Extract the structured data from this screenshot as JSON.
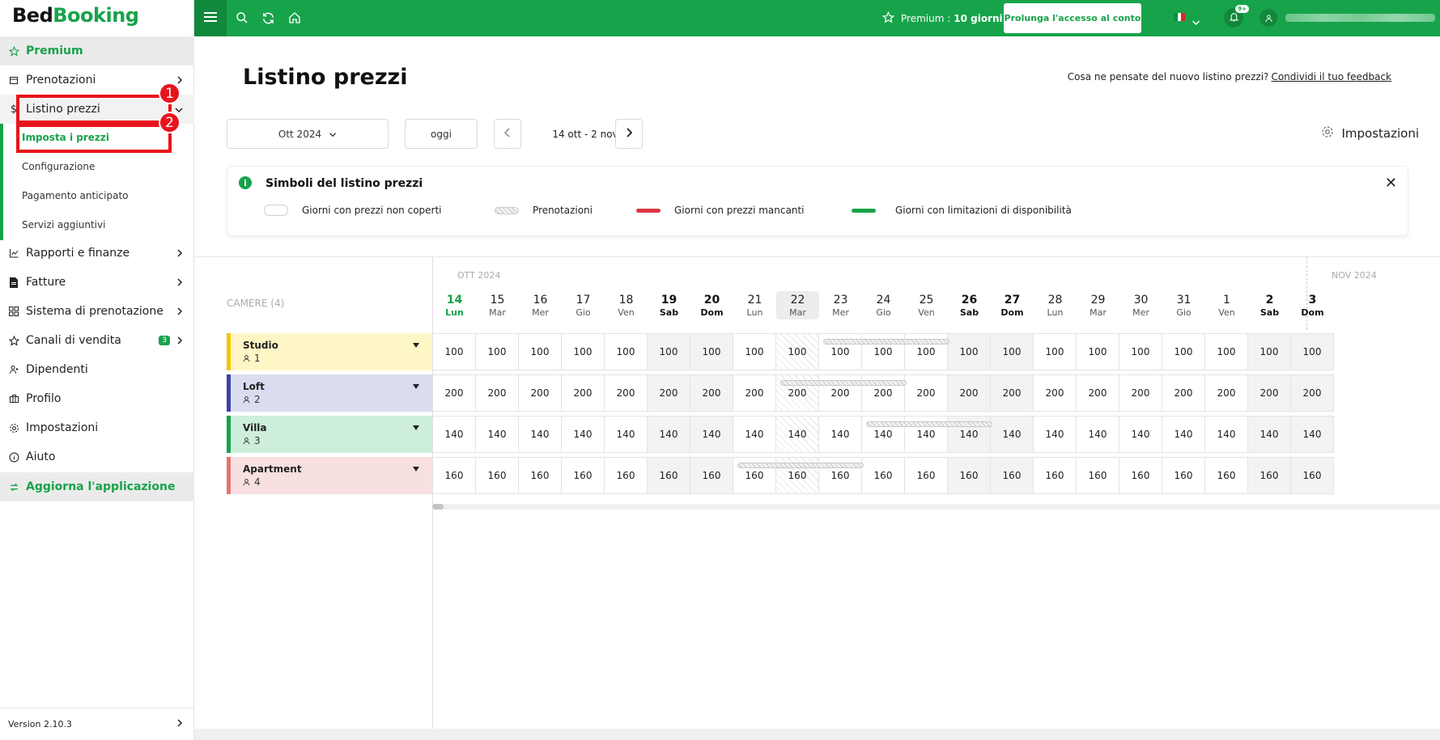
{
  "app": {
    "logo_part1": "Bed",
    "logo_part2": "Booking"
  },
  "sidebar": {
    "premium": "Premium",
    "items": [
      {
        "label": "Prenotazioni",
        "icon": "calendar-icon"
      },
      {
        "label": "Listino prezzi",
        "icon": "dollar-icon"
      },
      {
        "label": "Rapporti e finanze",
        "icon": "chart-icon"
      },
      {
        "label": "Fatture",
        "icon": "file-icon"
      },
      {
        "label": "Sistema di prenotazione",
        "icon": "grid-icon"
      },
      {
        "label": "Canali di vendita",
        "icon": "star-icon",
        "badge": "3"
      },
      {
        "label": "Dipendenti",
        "icon": "user-add-icon"
      },
      {
        "label": "Profilo",
        "icon": "briefcase-icon"
      },
      {
        "label": "Impostazioni",
        "icon": "gear-icon"
      },
      {
        "label": "Aiuto",
        "icon": "info-icon"
      }
    ],
    "subitems": [
      "Imposta i prezzi",
      "Configurazione",
      "Pagamento anticipato",
      "Servizi aggiuntivi"
    ],
    "upgrade": "Aggiorna l'applicazione",
    "version": "Version 2.10.3"
  },
  "annotations": [
    "1",
    "2"
  ],
  "topbar": {
    "premium_label": "Premium :",
    "premium_days": "10 giorni",
    "extend_button": "Prolunga l'accesso al conto",
    "notifications_badge": "9+"
  },
  "page": {
    "title": "Listino prezzi",
    "feedback_text": "Cosa ne pensate del nuovo listino prezzi?",
    "feedback_link": "Condividi il tuo feedback",
    "month_select": "Ott 2024",
    "today_button": "oggi",
    "range": "14 ott - 2 nov",
    "settings": "Impostazioni"
  },
  "legend": {
    "title": "Simboli del listino prezzi",
    "items": [
      "Giorni con prezzi non coperti",
      "Prenotazioni",
      "Giorni con prezzi mancanti",
      "Giorni con limitazioni di disponibilità"
    ],
    "colors": {
      "missing": "#dc3545",
      "limited": "#17a34a"
    }
  },
  "grid": {
    "camere_label": "CAMERE (4)",
    "months": [
      "OTT 2024",
      "NOV 2024"
    ],
    "days": [
      {
        "d": "14",
        "w": "Lun"
      },
      {
        "d": "15",
        "w": "Mar"
      },
      {
        "d": "16",
        "w": "Mer"
      },
      {
        "d": "17",
        "w": "Gio"
      },
      {
        "d": "18",
        "w": "Ven"
      },
      {
        "d": "19",
        "w": "Sab"
      },
      {
        "d": "20",
        "w": "Dom"
      },
      {
        "d": "21",
        "w": "Lun"
      },
      {
        "d": "22",
        "w": "Mar"
      },
      {
        "d": "23",
        "w": "Mer"
      },
      {
        "d": "24",
        "w": "Gio"
      },
      {
        "d": "25",
        "w": "Ven"
      },
      {
        "d": "26",
        "w": "Sab"
      },
      {
        "d": "27",
        "w": "Dom"
      },
      {
        "d": "28",
        "w": "Lun"
      },
      {
        "d": "29",
        "w": "Mar"
      },
      {
        "d": "30",
        "w": "Mer"
      },
      {
        "d": "31",
        "w": "Gio"
      },
      {
        "d": "1",
        "w": "Ven"
      },
      {
        "d": "2",
        "w": "Sab"
      },
      {
        "d": "3",
        "w": "Dom"
      }
    ],
    "rooms": [
      {
        "name": "Studio",
        "capacity": "1",
        "color": "#fff6c7",
        "border": "#f5c400",
        "price": "100"
      },
      {
        "name": "Loft",
        "capacity": "2",
        "color": "#dadcf0",
        "border": "#3b43a8",
        "price": "200"
      },
      {
        "name": "Villa",
        "capacity": "3",
        "color": "#cdeedb",
        "border": "#17a34a",
        "price": "140"
      },
      {
        "name": "Apartment",
        "capacity": "4",
        "color": "#f8e0e0",
        "border": "#e57373",
        "price": "160"
      }
    ]
  }
}
